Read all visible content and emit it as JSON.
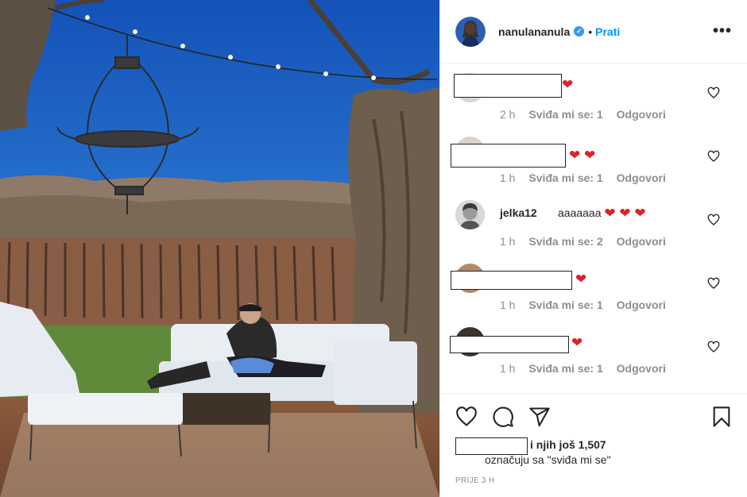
{
  "post": {
    "username": "nanulananula",
    "follow_label": "Prati",
    "more_label": "•••"
  },
  "comments": [
    {
      "name": "",
      "text": "",
      "emoji": "❤",
      "time": "2 h",
      "likes": "Sviđa mi se: 1",
      "reply": "Odgovori"
    },
    {
      "name": "",
      "text": "",
      "emoji": "❤ ❤",
      "time": "1 h",
      "likes": "Sviđa mi se: 1",
      "reply": "Odgovori"
    },
    {
      "name": "jelka12",
      "text": "aaaaaaa",
      "emoji": "❤ ❤ ❤",
      "time": "1 h",
      "likes": "Sviđa mi se: 2",
      "reply": "Odgovori"
    },
    {
      "name": "",
      "text": "",
      "emoji": "❤",
      "time": "1 h",
      "likes": "Sviđa mi se: 1",
      "reply": "Odgovori"
    },
    {
      "name": "",
      "text": "",
      "emoji": "❤",
      "time": "1 h",
      "likes": "Sviđa mi se: 1",
      "reply": "Odgovori"
    }
  ],
  "likes": {
    "line": "i njih još 1,507",
    "sub": "označuju sa \"sviđa mi se\""
  },
  "timestamp": "PRIJE 3 H",
  "colors": {
    "accent": "#0095f6",
    "heart": "#e0202a",
    "muted": "#8e8e8e"
  },
  "icons": [
    "like-icon",
    "comment-icon",
    "share-icon",
    "bookmark-icon",
    "verified-badge-icon"
  ]
}
